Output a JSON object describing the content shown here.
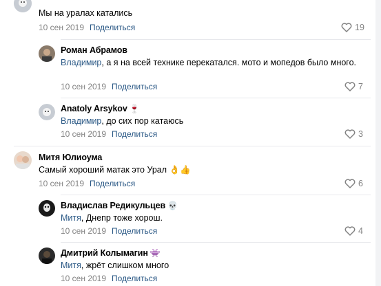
{
  "comments": [
    {
      "author": "",
      "text": "Мы на уралах катались",
      "date": "10 сен 2019",
      "share": "Поделиться",
      "likes": "19"
    },
    {
      "author": "Роман Абрамов",
      "mention": "Владимир",
      "text": ", а я на всей технике перекатался. мото и мопедов было много.",
      "date": "10 сен 2019",
      "share": "Поделиться",
      "likes": "7"
    },
    {
      "author": "Anatoly Arsykov",
      "author_emoji": "🍷",
      "mention": "Владимир",
      "text": ", до сих пор катаюсь",
      "date": "10 сен 2019",
      "share": "Поделиться",
      "likes": "3"
    },
    {
      "author": "Митя Юлиоума",
      "text": "Самый хороший матак это Урал 👌👍",
      "date": "10 сен 2019",
      "share": "Поделиться",
      "likes": "6"
    },
    {
      "author": "Владислав Редикульцев",
      "author_emoji": "💀",
      "mention": "Митя",
      "text": ", Днепр тоже хорош.",
      "date": "10 сен 2019",
      "share": "Поделиться",
      "likes": "4"
    },
    {
      "author": "Дмитрий Колымагин",
      "author_emoji": "👾",
      "mention": "Митя",
      "text": ", жрёт слишком много",
      "date": "10 сен 2019",
      "share": "Поделиться",
      "likes": ""
    }
  ],
  "colors": {
    "link": "#2a5885",
    "meta": "#828282",
    "divider": "#e7e8ec"
  },
  "icons": {
    "like": "heart-outline-icon"
  }
}
